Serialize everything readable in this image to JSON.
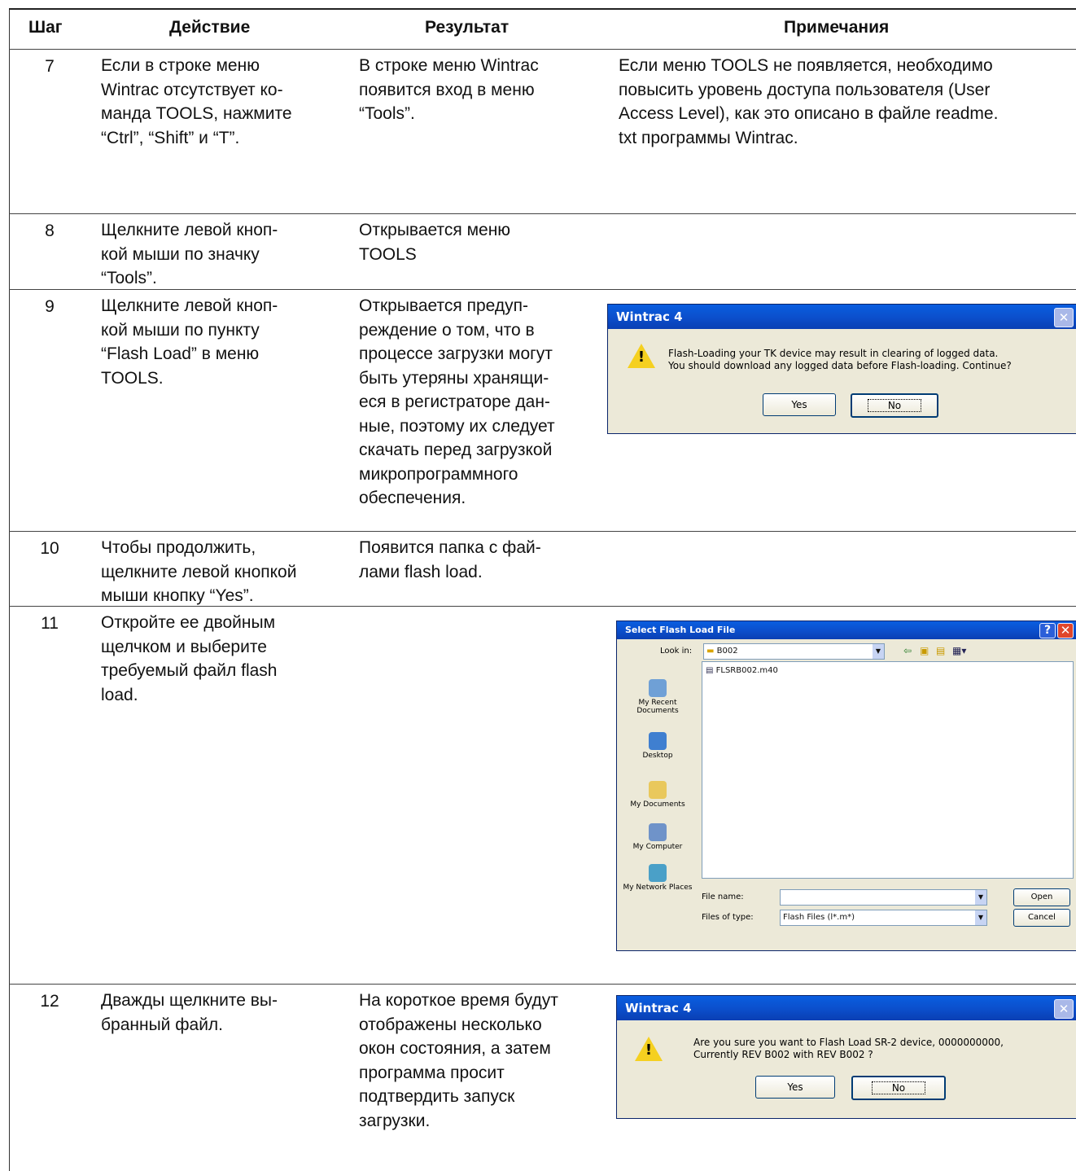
{
  "headers": {
    "step": "Шаг",
    "action": "Действие",
    "result": "Результат",
    "notes": "Примечания"
  },
  "rows": [
    {
      "step": "7",
      "action": "Если в строке меню\nWintrac отсутствует ко-\nманда TOOLS, нажмите\n“Ctrl”, “Shift” и “T”.",
      "result": "В строке меню Wintrac\nпоявится вход в меню\n“Tools”.",
      "notes": "Если меню TOOLS не появляется, необходимо\nповысить уровень доступа пользователя (User\nAccess Level), как это описано в файле readme.\ntxt программы Wintrac."
    },
    {
      "step": "8",
      "action": "Щелкните левой кноп-\nкой мыши по значку\n“Tools”.",
      "result": "Открывается меню\nTOOLS",
      "notes": ""
    },
    {
      "step": "9",
      "action": "Щелкните левой кноп-\nкой мыши по пункту\n“Flash Load” в меню\nTOOLS.",
      "result": "Открывается предуп-\nреждение о том, что в\nпроцессе загрузки могут\nбыть утеряны хранящи-\nеся в регистраторе дан-\nные, поэтому их следует\nскачать перед загрузкой\nмикропрограммного\nобеспечения.",
      "notes": ""
    },
    {
      "step": "10",
      "action": "Чтобы продолжить,\nщелкните левой кнопкой\nмыши кнопку “Yes”.",
      "result": "Появится папка с фай-\nлами flash load.",
      "notes": ""
    },
    {
      "step": "11",
      "action": "Откройте ее двойным\nщелчком и выберите\nтребуемый файл flash\nload.",
      "result": "",
      "notes": ""
    },
    {
      "step": "12",
      "action": "Дважды щелкните вы-\nбранный файл.",
      "result": "На короткое время будут\nотображены несколько\nокон состояния, а затем\nпрограмма просит\nподтвердить запуск\nзагрузки.",
      "notes": ""
    }
  ],
  "dialog1": {
    "title": "Wintrac 4",
    "message": "Flash-Loading your TK device may result in clearing of logged data.\nYou should download any logged data before Flash-loading. Continue?",
    "yes": "Yes",
    "no": "No"
  },
  "dialog2": {
    "title": "Select Flash Load File",
    "look_in_label": "Look in:",
    "look_in_value": "B002",
    "file_item": "FLSRB002.m40",
    "places": [
      "My Recent Documents",
      "Desktop",
      "My Documents",
      "My Computer",
      "My Network Places"
    ],
    "file_name_label": "File name:",
    "file_name_value": "",
    "files_of_type_label": "Files of type:",
    "files_of_type_value": "Flash Files (l*.m*)",
    "open": "Open",
    "cancel": "Cancel"
  },
  "dialog3": {
    "title": "Wintrac 4",
    "message": "Are you sure you want to Flash Load SR-2 device, 0000000000,\nCurrently REV B002 with REV B002 ?",
    "yes": "Yes",
    "no": "No"
  }
}
